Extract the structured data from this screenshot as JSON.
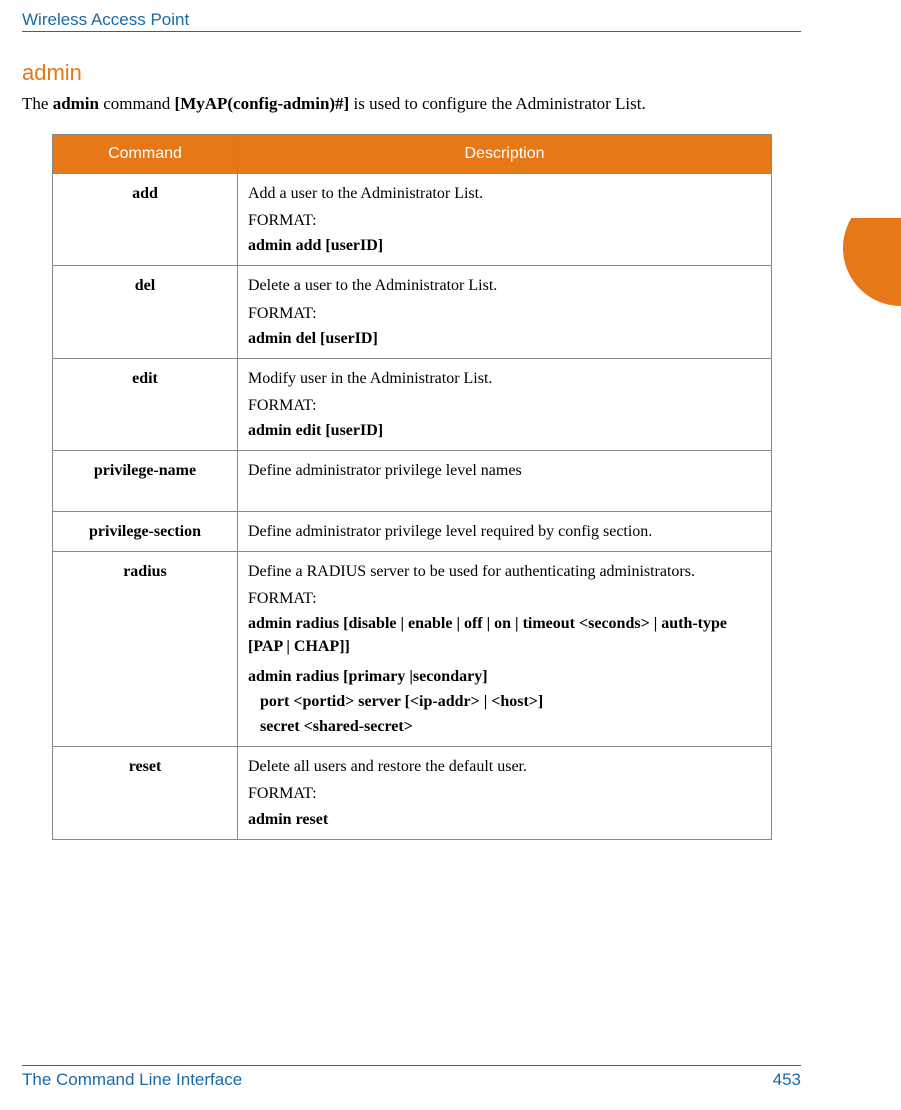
{
  "header": {
    "title": "Wireless Access Point"
  },
  "section": {
    "title": "admin",
    "intro_pre": "The ",
    "intro_cmd": "admin",
    "intro_mid": " command ",
    "intro_prompt": "[MyAP(config-admin)#]",
    "intro_post": " is used to configure the Administrator List."
  },
  "table": {
    "headers": {
      "command": "Command",
      "description": "Description"
    },
    "rows": [
      {
        "command": "add",
        "desc_main": "Add a user to the Administrator List.",
        "format_label": "FORMAT:",
        "format_lines": [
          "admin add [userID]"
        ]
      },
      {
        "command": "del",
        "desc_main": "Delete a user to the Administrator List.",
        "format_label": "FORMAT:",
        "format_lines": [
          "admin del [userID]"
        ]
      },
      {
        "command": "edit",
        "desc_main": "Modify user in the Administrator List.",
        "format_label": "FORMAT:",
        "format_lines": [
          "admin edit [userID]"
        ]
      },
      {
        "command": "privilege-name",
        "desc_main": "Define administrator privilege level names",
        "format_label": "",
        "format_lines": []
      },
      {
        "command": "privilege-section",
        "desc_main": "Define administrator privilege level required by config section.",
        "format_label": "",
        "format_lines": []
      },
      {
        "command": "radius",
        "desc_main": "Define a RADIUS server to be used for authenticating administrators.",
        "format_label": "FORMAT:",
        "format_lines": [
          "admin radius [disable | enable | off | on | timeout <seconds> | auth-type [PAP | CHAP]]",
          "admin radius [primary |secondary]"
        ],
        "format_sub_lines": [
          "port <portid> server [<ip-addr> | <host>]",
          "secret <shared-secret>"
        ]
      },
      {
        "command": "reset",
        "desc_main": "Delete all users and restore the default user.",
        "format_label": "FORMAT:",
        "format_lines": [
          "admin reset"
        ]
      }
    ]
  },
  "footer": {
    "left": "The Command Line Interface",
    "right": "453"
  }
}
